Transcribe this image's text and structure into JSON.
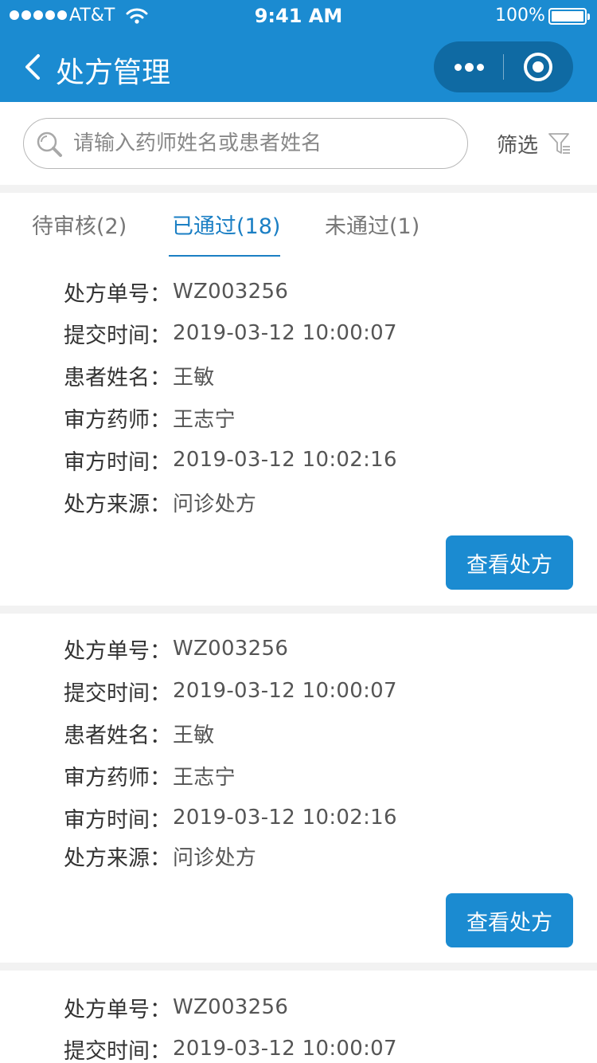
{
  "status_bar": {
    "carrier": "AT&T",
    "time": "9:41 AM",
    "battery": "100%"
  },
  "nav": {
    "title": "处方管理"
  },
  "search": {
    "placeholder": "请输入药师姓名或患者姓名",
    "value": "",
    "filter_label": "筛选"
  },
  "tabs": [
    {
      "label": "待审核(2)"
    },
    {
      "label": "已通过(18)",
      "active": true
    },
    {
      "label": "未通过(1)"
    }
  ],
  "prescriptions": [
    {
      "fields": [
        {
          "label": "处方单号：",
          "value": "WZ003256"
        },
        {
          "label": "提交时间：",
          "value": "2019-03-12  10:00:07"
        },
        {
          "label": "患者姓名：",
          "value": "王敏"
        },
        {
          "label": "审方药师：",
          "value": "王志宁"
        },
        {
          "label": "审方时间：",
          "value": "2019-03-12  10:02:16"
        },
        {
          "label": "处方来源：",
          "value": "问诊处方"
        }
      ],
      "button": "查看处方"
    },
    {
      "fields": [
        {
          "label": "处方单号：",
          "value": "WZ003256"
        },
        {
          "label": "提交时间：",
          "value": "2019-03-12  10:00:07"
        },
        {
          "label": "患者姓名：",
          "value": "王敏"
        },
        {
          "label": "审方药师：",
          "value": "王志宁"
        },
        {
          "label": "审方时间：",
          "value": "2019-03-12  10:02:16"
        },
        {
          "label": "处方来源：",
          "value": "问诊处方"
        }
      ],
      "button": "查看处方"
    },
    {
      "fields": [
        {
          "label": "处方单号：",
          "value": "WZ003256"
        },
        {
          "label": "提交时间：",
          "value": "2019-03-12  10:00:07"
        }
      ]
    }
  ],
  "colors": {
    "primary": "#1b8bd1",
    "capsule": "#0f6aa3",
    "active_tab": "#1b7fc4",
    "background": "#f2f2f2"
  },
  "icons": [
    "back-arrow-icon",
    "more-dots-icon",
    "close-circle-icon",
    "search-icon",
    "filter-icon",
    "wifi-icon",
    "battery-icon"
  ]
}
